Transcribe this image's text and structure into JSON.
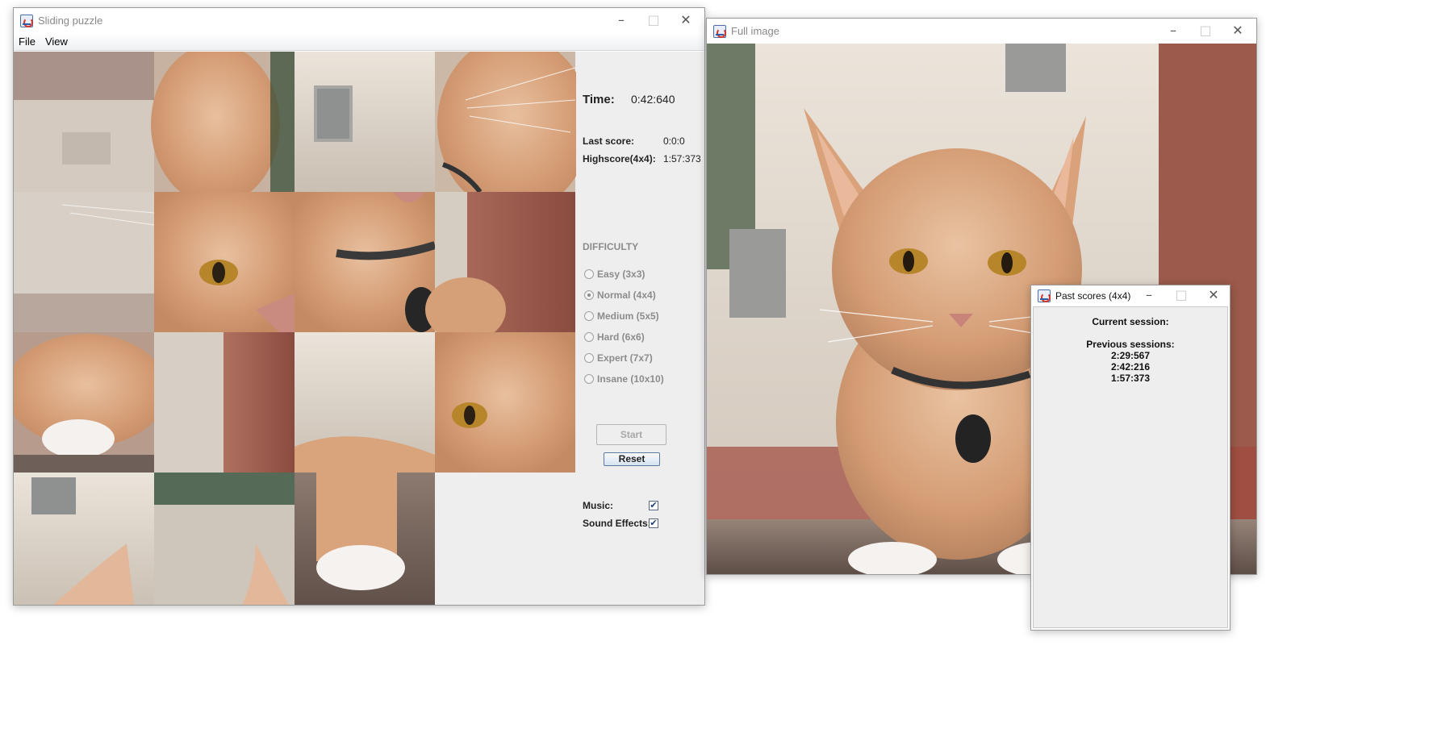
{
  "puzzle_window": {
    "title": "Sliding puzzle",
    "menu": [
      "File",
      "View"
    ],
    "tiles": [
      {
        "piece": 1
      },
      {
        "piece": 2
      },
      {
        "piece": 3
      },
      {
        "piece": 4
      },
      {
        "piece": 5
      },
      {
        "piece": 6
      },
      {
        "piece": 7
      },
      {
        "piece": 8
      },
      {
        "piece": 9
      },
      {
        "piece": 10
      },
      {
        "piece": 11
      },
      {
        "piece": 12
      },
      {
        "piece": 13
      },
      {
        "piece": 14
      },
      {
        "piece": 15
      },
      {
        "piece": null
      }
    ],
    "time_label": "Time:",
    "time_value": "0:42:640",
    "last_score_label": "Last score:",
    "last_score_value": "0:0:0",
    "highscore_label": "Highscore(4x4):",
    "highscore_value": "1:57:373",
    "difficulty_heading": "DIFFICULTY",
    "difficulties": [
      {
        "label": "Easy (3x3)",
        "selected": false
      },
      {
        "label": "Normal (4x4)",
        "selected": true
      },
      {
        "label": "Medium (5x5)",
        "selected": false
      },
      {
        "label": "Hard (6x6)",
        "selected": false
      },
      {
        "label": "Expert (7x7)",
        "selected": false
      },
      {
        "label": "Insane (10x10)",
        "selected": false
      }
    ],
    "start_label": "Start",
    "reset_label": "Reset",
    "music_label": "Music:",
    "music_checked": true,
    "sound_label": "Sound Effects:",
    "sound_checked": true
  },
  "image_window": {
    "title": "Full image"
  },
  "scores_window": {
    "title": "Past scores (4x4)",
    "current_label": "Current session:",
    "previous_label": "Previous sessions:",
    "previous_scores": [
      "2:29:567",
      "2:42:216",
      "1:57:373"
    ]
  },
  "icons": {
    "app": "java-app-icon",
    "minimize": "minimize-icon",
    "maximize": "maximize-icon",
    "close": "close-icon",
    "check": "check-icon"
  },
  "colors": {
    "panel_bg": "#eeeeee",
    "fur": "#d9a47c",
    "wall": "#e6ddd1",
    "brick": "#9b5a4b"
  }
}
